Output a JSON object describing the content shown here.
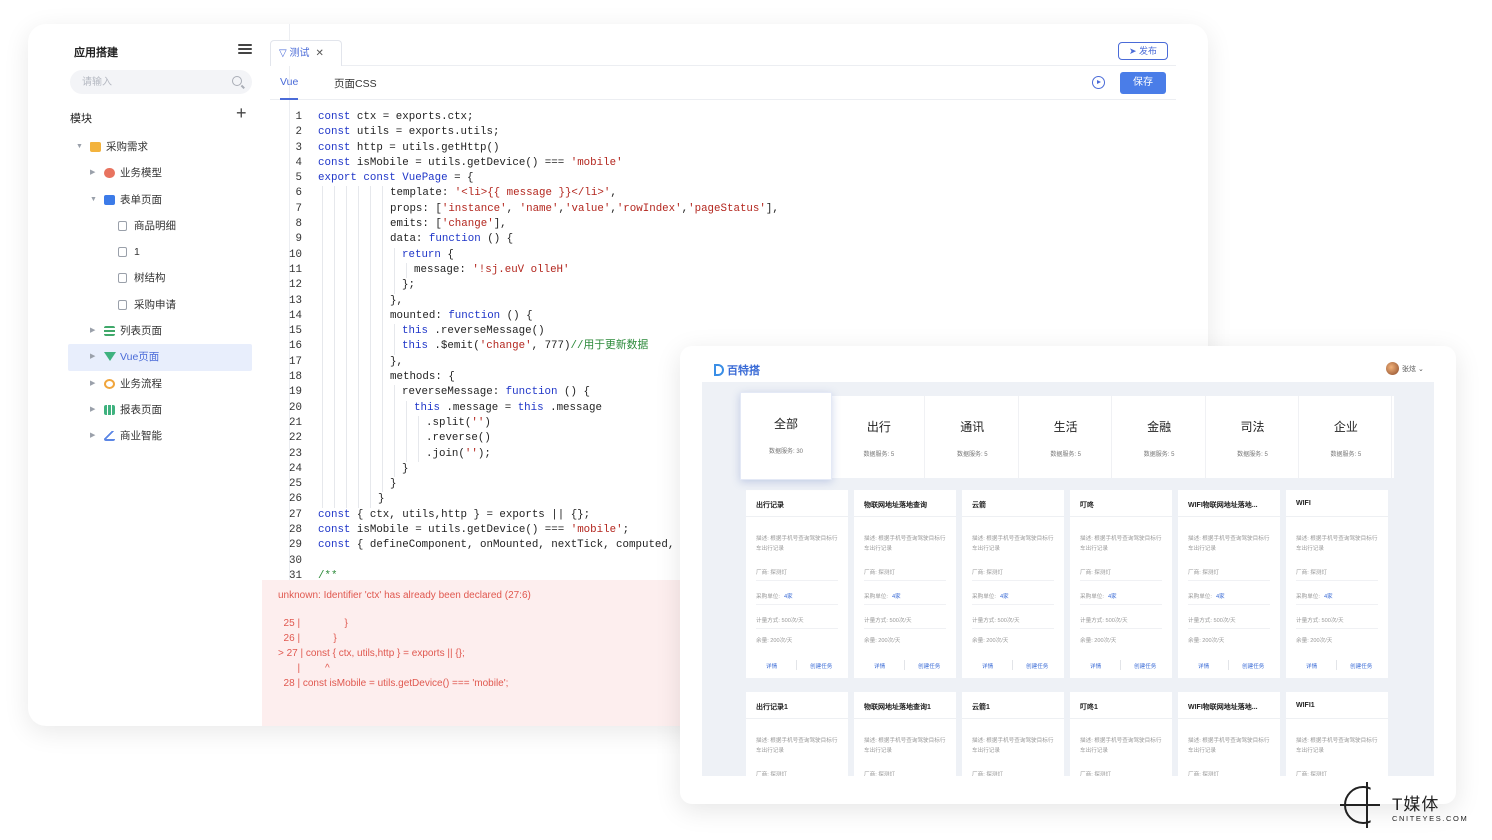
{
  "sidebar": {
    "title": "应用搭建",
    "search_placeholder": "请输入",
    "module_label": "模块",
    "add_label": "+",
    "tree": [
      {
        "label": "采购需求",
        "level": 0,
        "caret": "▼",
        "icon": "folder-icon"
      },
      {
        "label": "业务模型",
        "level": 1,
        "caret": "▶",
        "icon": "database-icon"
      },
      {
        "label": "表单页面",
        "level": 1,
        "caret": "▼",
        "icon": "form-doc-icon"
      },
      {
        "label": "商品明细",
        "level": 2,
        "caret": "",
        "icon": "page-icon"
      },
      {
        "label": "1",
        "level": 2,
        "caret": "",
        "icon": "page-icon"
      },
      {
        "label": "树结构",
        "level": 2,
        "caret": "",
        "icon": "page-icon"
      },
      {
        "label": "采购申请",
        "level": 2,
        "caret": "",
        "icon": "page-icon"
      },
      {
        "label": "列表页面",
        "level": 1,
        "caret": "▶",
        "icon": "list-icon"
      },
      {
        "label": "Vue页面",
        "level": 1,
        "caret": "▶",
        "icon": "vue-icon",
        "active": true
      },
      {
        "label": "业务流程",
        "level": 1,
        "caret": "▶",
        "icon": "flow-icon"
      },
      {
        "label": "报表页面",
        "level": 1,
        "caret": "▶",
        "icon": "report-icon"
      },
      {
        "label": "商业智能",
        "level": 1,
        "caret": "▶",
        "icon": "bi-icon"
      }
    ]
  },
  "tabs": {
    "active_tab": "测试",
    "close_glyph": "✕",
    "publish_label": "发布",
    "sub": [
      "Vue",
      "页面CSS"
    ],
    "save_label": "保存"
  },
  "code": {
    "lines": [
      {
        "n": "1",
        "indent": 0,
        "segs": [
          [
            "kw",
            "const"
          ],
          [
            "",
            "ctx = exports.ctx;"
          ]
        ]
      },
      {
        "n": "2",
        "indent": 0,
        "segs": [
          [
            "kw",
            "const"
          ],
          [
            "",
            "utils = exports.utils;"
          ]
        ]
      },
      {
        "n": "3",
        "indent": 0,
        "segs": [
          [
            "kw",
            "const"
          ],
          [
            "",
            "http = utils.getHttp()"
          ]
        ]
      },
      {
        "n": "4",
        "indent": 0,
        "segs": [
          [
            "kw",
            "const"
          ],
          [
            "",
            "isMobile = utils.getDevice() === "
          ],
          [
            "str",
            "'mobile'"
          ]
        ]
      },
      {
        "n": "5",
        "indent": 0,
        "segs": [
          [
            "kw",
            "export const"
          ],
          [
            "fn",
            "VuePage"
          ],
          [
            "",
            "= {"
          ]
        ]
      },
      {
        "n": "6",
        "indent": 6,
        "segs": [
          [
            "",
            "template: "
          ],
          [
            "str",
            "'<li>{{ message }}</li>'"
          ],
          [
            "",
            ","
          ]
        ]
      },
      {
        "n": "7",
        "indent": 6,
        "segs": [
          [
            "",
            "props: ["
          ],
          [
            "str",
            "'instance'"
          ],
          [
            "",
            ", "
          ],
          [
            "str",
            "'name'"
          ],
          [
            "",
            ","
          ],
          [
            "str",
            "'value'"
          ],
          [
            "",
            ","
          ],
          [
            "str",
            "'rowIndex'"
          ],
          [
            "",
            ","
          ],
          [
            "str",
            "'pageStatus'"
          ],
          [
            "",
            "],"
          ]
        ]
      },
      {
        "n": "8",
        "indent": 6,
        "segs": [
          [
            "",
            "emits: ["
          ],
          [
            "str",
            "'change'"
          ],
          [
            "",
            "],"
          ]
        ]
      },
      {
        "n": "9",
        "indent": 6,
        "segs": [
          [
            "",
            "data: "
          ],
          [
            "kw",
            "function"
          ],
          [
            "",
            "() {"
          ]
        ]
      },
      {
        "n": "10",
        "indent": 7,
        "segs": [
          [
            "kw",
            "return"
          ],
          [
            "",
            "{"
          ]
        ]
      },
      {
        "n": "11",
        "indent": 8,
        "segs": [
          [
            "",
            "message: "
          ],
          [
            "str",
            "'!sj.euV olleH'"
          ]
        ]
      },
      {
        "n": "12",
        "indent": 7,
        "segs": [
          [
            "",
            "};"
          ]
        ]
      },
      {
        "n": "13",
        "indent": 6,
        "segs": [
          [
            "",
            "},"
          ]
        ]
      },
      {
        "n": "14",
        "indent": 6,
        "segs": [
          [
            "",
            "mounted: "
          ],
          [
            "kw",
            "function"
          ],
          [
            "",
            "() {"
          ]
        ]
      },
      {
        "n": "15",
        "indent": 7,
        "segs": [
          [
            "kw",
            "this"
          ],
          [
            "",
            ".reverseMessage()"
          ]
        ]
      },
      {
        "n": "16",
        "indent": 7,
        "segs": [
          [
            "kw",
            "this"
          ],
          [
            "",
            ".$emit("
          ],
          [
            "str",
            "'change'"
          ],
          [
            "",
            ", 777)"
          ],
          [
            "cm",
            "//用于更新数据"
          ]
        ]
      },
      {
        "n": "17",
        "indent": 6,
        "segs": [
          [
            "",
            "},"
          ]
        ]
      },
      {
        "n": "18",
        "indent": 6,
        "segs": [
          [
            "",
            "methods: {"
          ]
        ]
      },
      {
        "n": "19",
        "indent": 7,
        "segs": [
          [
            "",
            "reverseMessage: "
          ],
          [
            "kw",
            "function"
          ],
          [
            "",
            "() {"
          ]
        ]
      },
      {
        "n": "20",
        "indent": 8,
        "segs": [
          [
            "kw",
            "this"
          ],
          [
            "",
            ".message = "
          ],
          [
            "kw",
            "this"
          ],
          [
            "",
            ".message"
          ]
        ]
      },
      {
        "n": "21",
        "indent": 9,
        "segs": [
          [
            "",
            ".split("
          ],
          [
            "str",
            "''"
          ],
          [
            "",
            ")"
          ]
        ]
      },
      {
        "n": "22",
        "indent": 9,
        "segs": [
          [
            "",
            ".reverse()"
          ]
        ]
      },
      {
        "n": "23",
        "indent": 9,
        "segs": [
          [
            "",
            ".join("
          ],
          [
            "str",
            "''"
          ],
          [
            "",
            ");"
          ]
        ]
      },
      {
        "n": "24",
        "indent": 7,
        "segs": [
          [
            "",
            "}"
          ]
        ]
      },
      {
        "n": "25",
        "indent": 6,
        "segs": [
          [
            "",
            "}"
          ]
        ]
      },
      {
        "n": "26",
        "indent": 5,
        "segs": [
          [
            "",
            "}"
          ]
        ]
      },
      {
        "n": "27",
        "indent": 0,
        "segs": [
          [
            "kw",
            "const"
          ],
          [
            "",
            "{ ctx, utils,http } = exports || {};"
          ]
        ]
      },
      {
        "n": "28",
        "indent": 0,
        "segs": [
          [
            "kw",
            "const"
          ],
          [
            "",
            "isMobile = utils.getDevice() === "
          ],
          [
            "str",
            "'mobile'"
          ],
          [
            "",
            ";"
          ]
        ]
      },
      {
        "n": "29",
        "indent": 0,
        "segs": [
          [
            "kw",
            "const"
          ],
          [
            "",
            "{ defineComponent, onMounted, nextTick, computed, ref,"
          ]
        ]
      },
      {
        "n": "30",
        "indent": 0,
        "segs": []
      },
      {
        "n": "31",
        "indent": 0,
        "segs": [
          [
            "cm",
            "/**"
          ]
        ]
      }
    ]
  },
  "error": {
    "title": "unknown: Identifier 'ctx' has already been declared (27:6)",
    "lines": [
      "  25 |                }",
      "  26 |            }",
      "> 27 | const { ctx, utils,http } = exports || {};",
      "       |         ^",
      "  28 | const isMobile = utils.getDevice() === 'mobile';"
    ]
  },
  "preview": {
    "logo": "百特搭",
    "user": "张炫 ⌄",
    "categories": [
      {
        "name": "全部",
        "count": "数据服务: 30",
        "active": true
      },
      {
        "name": "出行",
        "count": "数据服务: 5"
      },
      {
        "name": "通讯",
        "count": "数据服务: 5"
      },
      {
        "name": "生活",
        "count": "数据服务: 5"
      },
      {
        "name": "金融",
        "count": "数据服务: 5"
      },
      {
        "name": "司法",
        "count": "数据服务: 5"
      },
      {
        "name": "企业",
        "count": "数据服务: 5"
      }
    ],
    "cards_row1": [
      {
        "title": "出行记录"
      },
      {
        "title": "物联网地址落地查询"
      },
      {
        "title": "云箭"
      },
      {
        "title": "叮咚"
      },
      {
        "title": "WIFI物联网地址落地..."
      },
      {
        "title": "WIFI"
      }
    ],
    "cards_row2": [
      {
        "title": "出行记录1"
      },
      {
        "title": "物联网地址落地查询1"
      },
      {
        "title": "云箭1"
      },
      {
        "title": "叮咚1"
      },
      {
        "title": "WIFI物联网地址落地..."
      },
      {
        "title": "WIFI1"
      }
    ],
    "card_desc": "描述: 根据手机号查询驾驶目标行车出行记录",
    "card_vendor": "厂商: 探测灯",
    "card_unit_label": "采购单位:",
    "card_unit_value": "4家",
    "card_price": "计量方式: 500次/天",
    "card_stock": "余量: 200次/天",
    "card_detail": "详情",
    "card_task": "创建任务"
  },
  "watermark": {
    "cn": "T媒体",
    "en": "CNITEYES.COM"
  }
}
